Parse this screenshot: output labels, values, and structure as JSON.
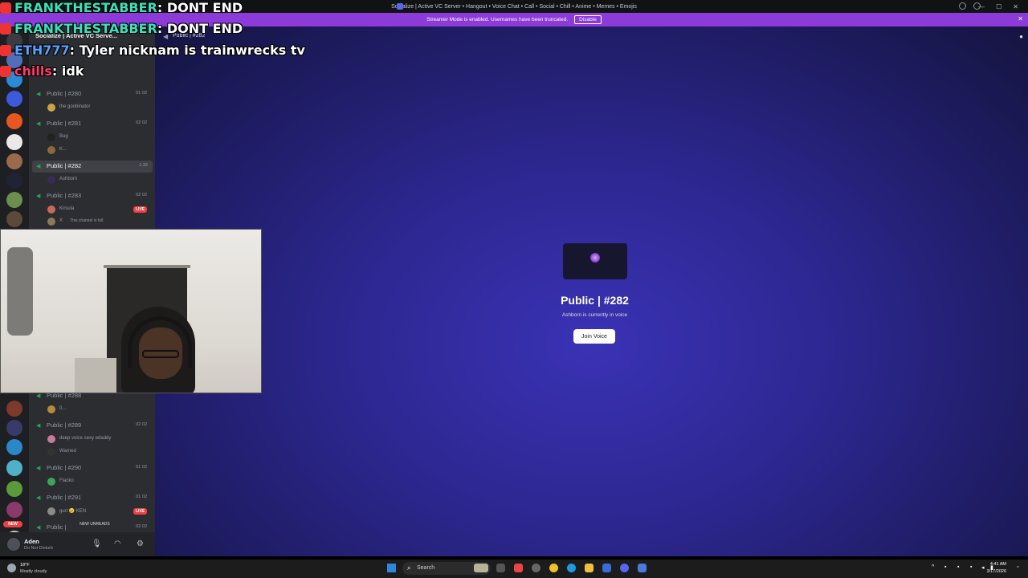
{
  "window": {
    "title": "Socialize | Active VC Server • Hangout • Voice Chat • Call • Social • Chill • Anime • Memes • Emojis",
    "minimize": "—",
    "maximize": "☐",
    "close": "✕"
  },
  "banner": {
    "text": "Streamer Mode is enabled. Usernames have been truncated.",
    "disable_label": "Disable",
    "close_glyph": "✕"
  },
  "sidebar": {
    "server_name": "Socialize | Active VC Serve...",
    "channels": [
      {
        "name": "Public | #280",
        "count": "01  02",
        "members": [
          "the goobinator"
        ]
      },
      {
        "name": "Public | #281",
        "count": "02  02",
        "members": [
          "Bug",
          "K..."
        ]
      },
      {
        "name": "Public | #282",
        "count": "1:32",
        "members": [
          "Ashborn"
        ],
        "selected": true
      },
      {
        "name": "Public | #283",
        "count": "02  02",
        "members": [
          "Kirsula",
          "X"
        ],
        "live": "LIVE",
        "full_note": "This channel is full."
      },
      {
        "name": "Public | #288",
        "count": "",
        "members": [
          "0..."
        ]
      },
      {
        "name": "Public | #289",
        "count": "02  02",
        "members": [
          "deep voice sexy edaddy",
          "Warned"
        ]
      },
      {
        "name": "Public | #290",
        "count": "01  02",
        "members": [
          "Flacko"
        ]
      },
      {
        "name": "Public | #291",
        "count": "01  02",
        "members": [
          "gurl 😢 KEN"
        ],
        "live": "LIVE"
      },
      {
        "name": "Public |",
        "count": "02  02",
        "members": []
      }
    ],
    "new_unreads": "NEW UNREADS",
    "new_badge": "NEW"
  },
  "user_panel": {
    "name": "Aden",
    "status": "Do Not Disturb"
  },
  "main": {
    "header_label": "Public | #282",
    "channel_title": "Public | #282",
    "subtitle": "Ashborn is currently in voice",
    "join_label": "Join Voice"
  },
  "overlay_chat": [
    {
      "author": "FRANKTHESTABBER",
      "text": ": DONT END"
    },
    {
      "author": "FRANKTHESTABBER",
      "text": ": DONT END"
    },
    {
      "author": "ETH777",
      "text": ": Tyler nicknam is trainwrecks tv"
    },
    {
      "author": "chills",
      "text": ": idk"
    }
  ],
  "taskbar": {
    "weather_temp": "18°F",
    "weather_desc": "Mostly cloudy",
    "search_label": "Search",
    "time": "4:41 AM",
    "date": "3/17/2026"
  },
  "colors": {
    "accent": "#5865f2",
    "banner": "#8c3ad8",
    "online_green": "#23a559",
    "live_red": "#f23f43"
  }
}
